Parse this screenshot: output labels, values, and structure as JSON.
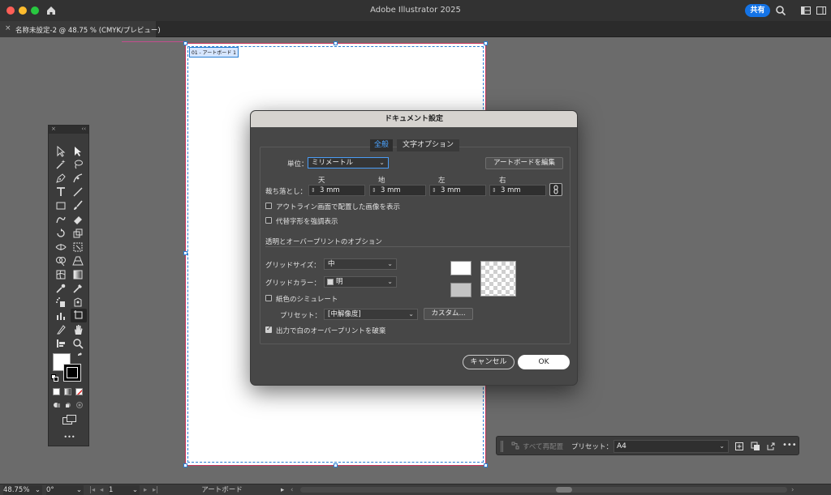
{
  "window": {
    "title": "Adobe Illustrator 2025",
    "share_label": "共有"
  },
  "document_tab": {
    "close_glyph": "×",
    "label": "名称未設定-2 @ 48.75 % (CMYK/プレビュー)"
  },
  "artboard": {
    "label": "01 - アートボード 1"
  },
  "dialog": {
    "title": "ドキュメント設定",
    "tabs": [
      {
        "label": "全般",
        "active": true
      },
      {
        "label": "文字オプション",
        "active": false
      }
    ],
    "units_label": "単位：",
    "units_value": "ミリメートル",
    "edit_artboards_label": "アートボードを編集",
    "bleed_label": "裁ち落とし：",
    "bleed_headers": [
      "天",
      "地",
      "左",
      "右"
    ],
    "bleed_values": [
      "3 mm",
      "3 mm",
      "3 mm",
      "3 mm"
    ],
    "checkboxes_top": [
      {
        "label": "アウトライン画面で配置した画像を表示",
        "checked": false
      },
      {
        "label": "代替字形を強調表示",
        "checked": false
      }
    ],
    "section_title": "透明とオーバープリントのオプション",
    "grid_size_label": "グリッドサイズ：",
    "grid_size_value": "中",
    "grid_color_label": "グリッドカラー：",
    "grid_color_value": "明",
    "simulate_paper": {
      "label": "紙色のシミュレート",
      "checked": false
    },
    "preset_label": "プリセット：",
    "preset_value": "[中解像度]",
    "custom_label": "カスタム...",
    "discard_white": {
      "label": "出力で白のオーバープリントを破棄",
      "checked": true
    },
    "cancel_label": "キャンセル",
    "ok_label": "OK"
  },
  "context_bar": {
    "relayout_label": "すべて再配置",
    "preset_label": "プリセット：",
    "preset_value": "A4",
    "more_glyph": "•••"
  },
  "status_bar": {
    "zoom": "48.75%",
    "rotation": "0°",
    "artboard_number": "1",
    "tool_label": "アートボード"
  },
  "tools_panel": {
    "close_glyph": "×",
    "collapse_glyph": "‹‹",
    "more_glyph": "•••"
  },
  "colors": {
    "accent": "#1473e6",
    "artboard_border": "#c8325a",
    "bleed_guide": "#2a7fd4"
  }
}
